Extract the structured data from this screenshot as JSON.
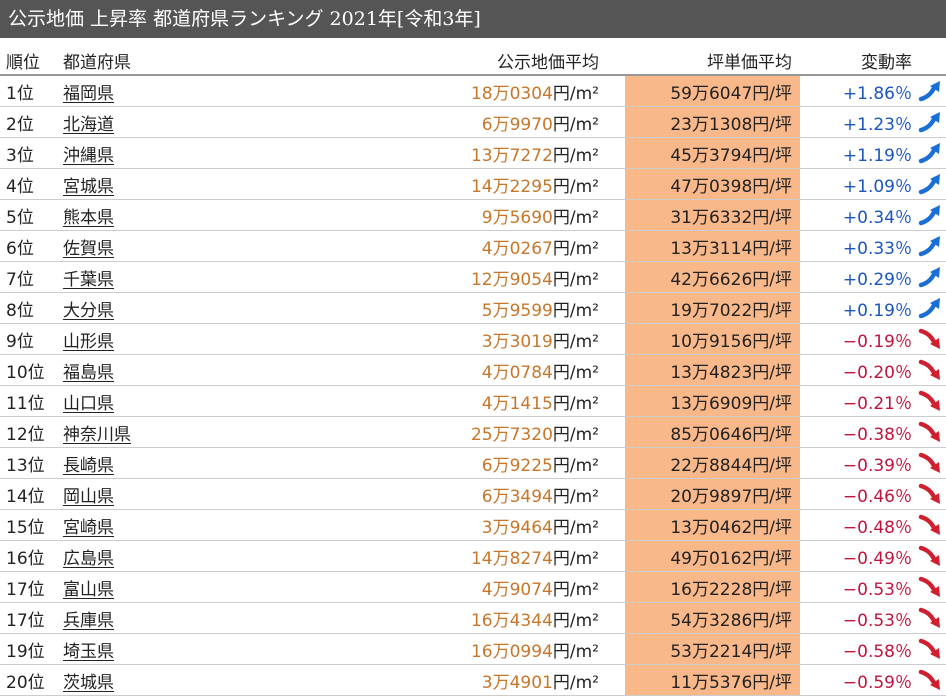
{
  "title": "公示地価 上昇率 都道府県ランキング 2021年[令和3年]",
  "headers": {
    "rank": "順位",
    "prefecture": "都道府県",
    "avg_price": "公示地価平均",
    "tsubo_price": "坪単価平均",
    "change_rate": "変動率"
  },
  "units": {
    "sqm": "円/m²",
    "tsubo": "円/坪"
  },
  "colors": {
    "up": "#1a55c0",
    "down": "#c0143c",
    "price": "#c8762a",
    "tsubo_bg": "#f9b88a",
    "title_bg": "#555555"
  },
  "rows": [
    {
      "rank": "1位",
      "pref": "福岡県",
      "avg": "18万0304",
      "tsubo": "59万6047",
      "rate": "+1.86％",
      "dir": "up"
    },
    {
      "rank": "2位",
      "pref": "北海道",
      "avg": "6万9970",
      "tsubo": "23万1308",
      "rate": "+1.23％",
      "dir": "up"
    },
    {
      "rank": "3位",
      "pref": "沖縄県",
      "avg": "13万7272",
      "tsubo": "45万3794",
      "rate": "+1.19％",
      "dir": "up"
    },
    {
      "rank": "4位",
      "pref": "宮城県",
      "avg": "14万2295",
      "tsubo": "47万0398",
      "rate": "+1.09％",
      "dir": "up"
    },
    {
      "rank": "5位",
      "pref": "熊本県",
      "avg": "9万5690",
      "tsubo": "31万6332",
      "rate": "+0.34％",
      "dir": "up"
    },
    {
      "rank": "6位",
      "pref": "佐賀県",
      "avg": "4万0267",
      "tsubo": "13万3114",
      "rate": "+0.33％",
      "dir": "up"
    },
    {
      "rank": "7位",
      "pref": "千葉県",
      "avg": "12万9054",
      "tsubo": "42万6626",
      "rate": "+0.29％",
      "dir": "up"
    },
    {
      "rank": "8位",
      "pref": "大分県",
      "avg": "5万9599",
      "tsubo": "19万7022",
      "rate": "+0.19％",
      "dir": "up"
    },
    {
      "rank": "9位",
      "pref": "山形県",
      "avg": "3万3019",
      "tsubo": "10万9156",
      "rate": "−0.19％",
      "dir": "down"
    },
    {
      "rank": "10位",
      "pref": "福島県",
      "avg": "4万0784",
      "tsubo": "13万4823",
      "rate": "−0.20％",
      "dir": "down"
    },
    {
      "rank": "11位",
      "pref": "山口県",
      "avg": "4万1415",
      "tsubo": "13万6909",
      "rate": "−0.21％",
      "dir": "down"
    },
    {
      "rank": "12位",
      "pref": "神奈川県",
      "avg": "25万7320",
      "tsubo": "85万0646",
      "rate": "−0.38％",
      "dir": "down"
    },
    {
      "rank": "13位",
      "pref": "長崎県",
      "avg": "6万9225",
      "tsubo": "22万8844",
      "rate": "−0.39％",
      "dir": "down"
    },
    {
      "rank": "14位",
      "pref": "岡山県",
      "avg": "6万3494",
      "tsubo": "20万9897",
      "rate": "−0.46％",
      "dir": "down"
    },
    {
      "rank": "15位",
      "pref": "宮崎県",
      "avg": "3万9464",
      "tsubo": "13万0462",
      "rate": "−0.48％",
      "dir": "down"
    },
    {
      "rank": "16位",
      "pref": "広島県",
      "avg": "14万8274",
      "tsubo": "49万0162",
      "rate": "−0.49％",
      "dir": "down"
    },
    {
      "rank": "17位",
      "pref": "富山県",
      "avg": "4万9074",
      "tsubo": "16万2228",
      "rate": "−0.53％",
      "dir": "down"
    },
    {
      "rank": "17位",
      "pref": "兵庫県",
      "avg": "16万4344",
      "tsubo": "54万3286",
      "rate": "−0.53％",
      "dir": "down"
    },
    {
      "rank": "19位",
      "pref": "埼玉県",
      "avg": "16万0994",
      "tsubo": "53万2214",
      "rate": "−0.58％",
      "dir": "down"
    },
    {
      "rank": "20位",
      "pref": "茨城県",
      "avg": "3万4901",
      "tsubo": "11万5376",
      "rate": "−0.59％",
      "dir": "down"
    }
  ]
}
